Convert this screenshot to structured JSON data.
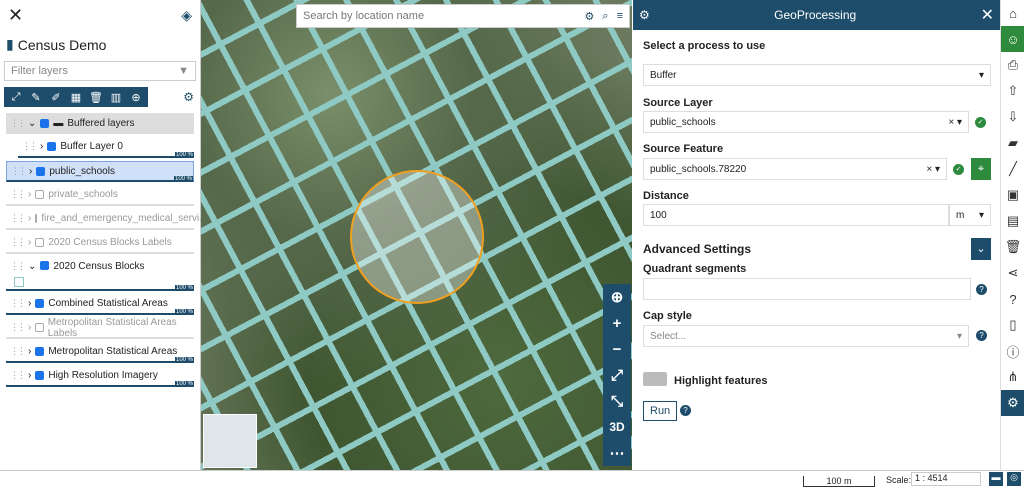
{
  "left": {
    "title": "Census Demo",
    "filter_placeholder": "Filter layers",
    "layers": [
      {
        "label": "Buffered layers",
        "type": "group"
      },
      {
        "label": "Buffer Layer 0",
        "pct": "100 %"
      },
      {
        "label": "public_schools",
        "pct": "100 %"
      },
      {
        "label": "private_schools"
      },
      {
        "label": "fire_and_emergency_medical_servi..."
      },
      {
        "label": "2020 Census Blocks Labels"
      },
      {
        "label": "2020 Census Blocks",
        "pct": "100 %"
      },
      {
        "label": "Combined Statistical Areas",
        "pct": "100 %"
      },
      {
        "label": "Metropolitan Statistical Areas Labels"
      },
      {
        "label": "Metropolitan Statistical Areas",
        "pct": "100 %"
      },
      {
        "label": "High Resolution Imagery",
        "pct": "100 %"
      }
    ]
  },
  "map": {
    "search_placeholder": "Search by location name",
    "btn_3d": "3D"
  },
  "geo": {
    "title": "GeoProcessing",
    "select_process_label": "Select a process to use",
    "process_value": "Buffer",
    "source_layer_label": "Source Layer",
    "source_layer_value": "public_schools",
    "source_feature_label": "Source Feature",
    "source_feature_value": "public_schools.78220",
    "distance_label": "Distance",
    "distance_value": "100",
    "distance_unit": "m",
    "advanced_label": "Advanced Settings",
    "quadrant_label": "Quadrant segments",
    "cap_label": "Cap style",
    "cap_placeholder": "Select...",
    "highlight_label": "Highlight features",
    "run_label": "Run"
  },
  "status": {
    "scale_bar": "100 m",
    "scale_label": "Scale:",
    "scale_value": "1 : 4514"
  },
  "colors": {
    "accent": "#1e4d6b",
    "buffer": "#f0a020",
    "ok": "#2e8b3e"
  }
}
